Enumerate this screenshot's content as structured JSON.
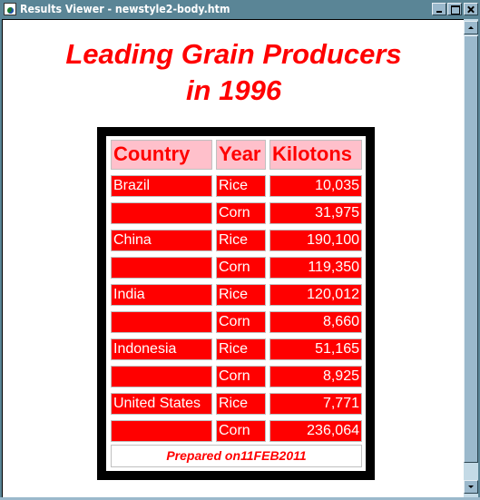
{
  "window": {
    "title": "Results Viewer - newstyle2-body.htm",
    "icon": "document-globe-icon",
    "controls": [
      "minimize",
      "maximize",
      "close"
    ]
  },
  "page": {
    "heading_line1": "Leading Grain Producers",
    "heading_line2": "in 1996",
    "table": {
      "headers": [
        "Country",
        "Year",
        "Kilotons"
      ],
      "rows": [
        {
          "country": "Brazil",
          "year": "Rice",
          "kilotons": "10,035"
        },
        {
          "country": "",
          "year": "Corn",
          "kilotons": "31,975"
        },
        {
          "country": "China",
          "year": "Rice",
          "kilotons": "190,100"
        },
        {
          "country": "",
          "year": "Corn",
          "kilotons": "119,350"
        },
        {
          "country": "India",
          "year": "Rice",
          "kilotons": "120,012"
        },
        {
          "country": "",
          "year": "Corn",
          "kilotons": "8,660"
        },
        {
          "country": "Indonesia",
          "year": "Rice",
          "kilotons": "51,165"
        },
        {
          "country": "",
          "year": "Corn",
          "kilotons": "8,925"
        },
        {
          "country": "United States",
          "year": "Rice",
          "kilotons": "7,771"
        },
        {
          "country": "",
          "year": "Corn",
          "kilotons": "236,064"
        }
      ],
      "footer": "Prepared on11FEB2011"
    }
  },
  "colors": {
    "accent": "#ff0000",
    "header_bg": "#ffc0cb",
    "frame": "#000000",
    "titlebar": "#5a8596"
  }
}
